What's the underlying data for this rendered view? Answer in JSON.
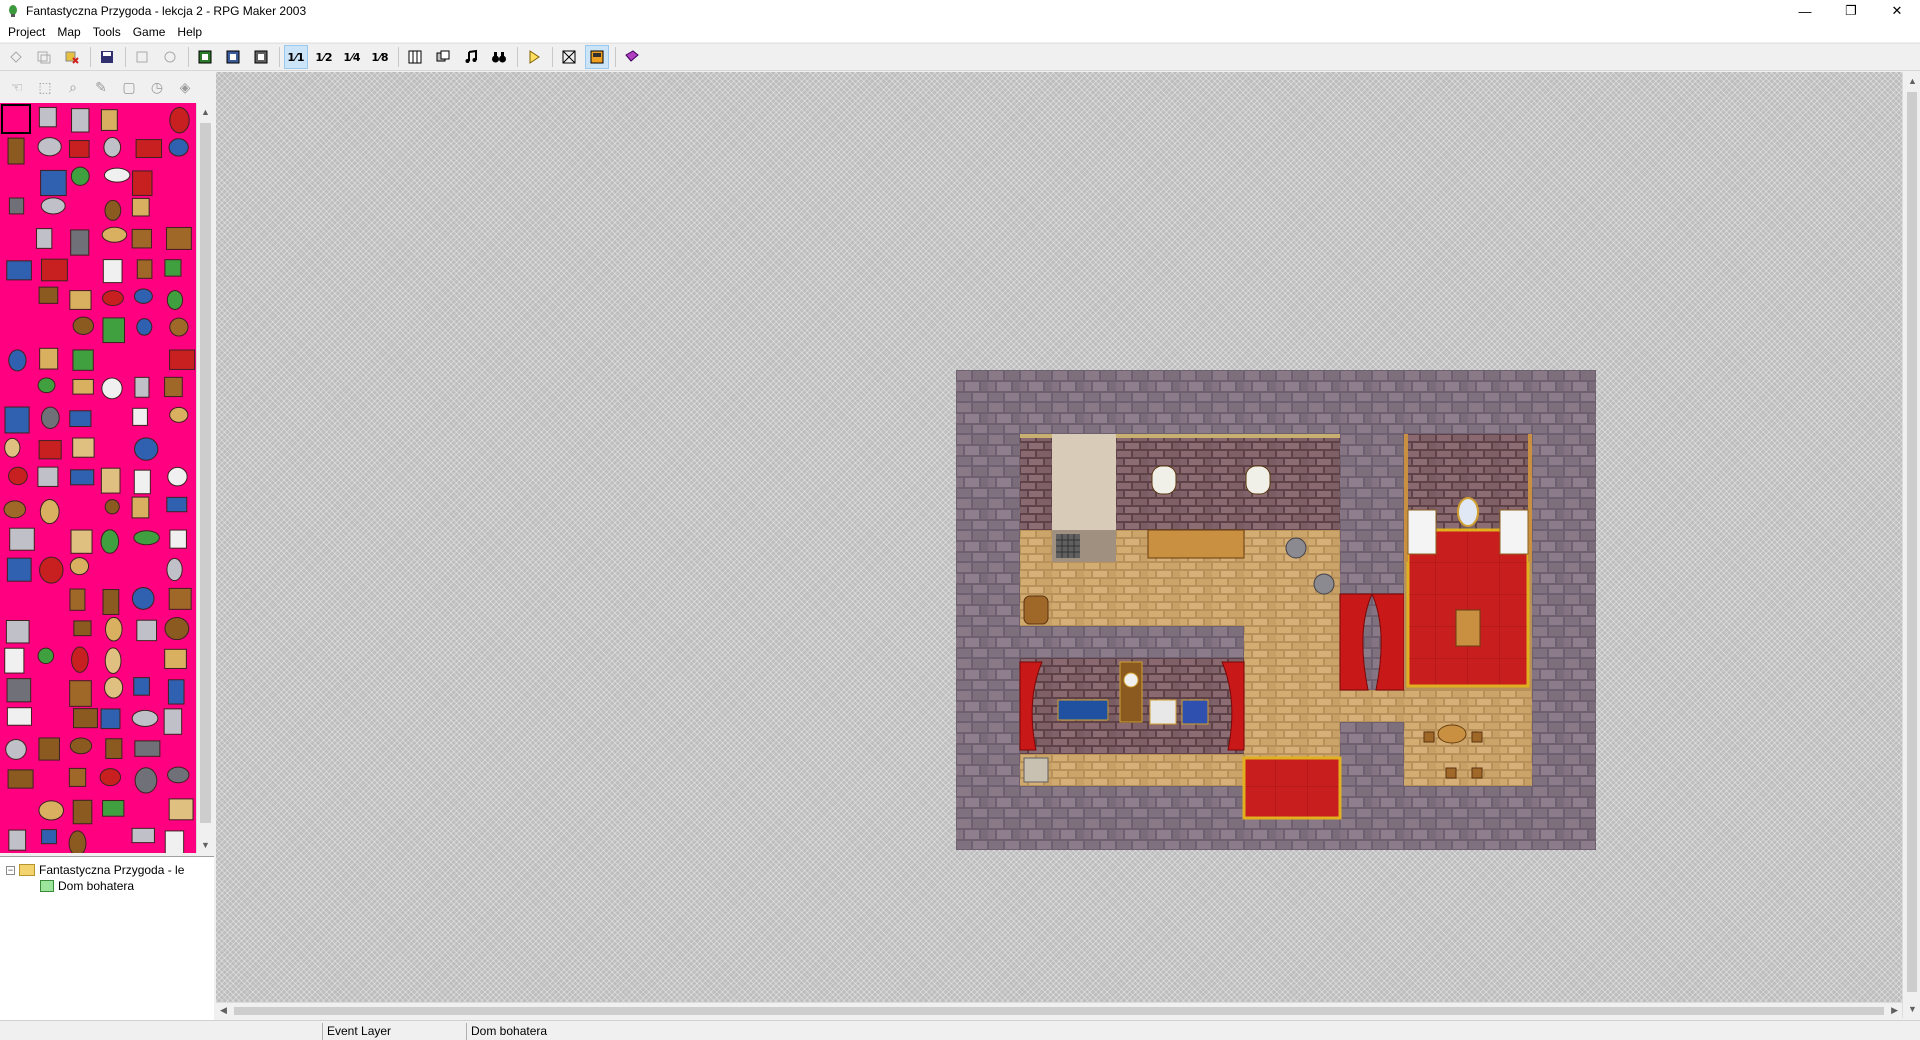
{
  "window": {
    "title": "Fantastyczna Przygoda - lekcja 2 - RPG Maker 2003",
    "minimize": "—",
    "restore": "❐",
    "close": "✕"
  },
  "menu": [
    "Project",
    "Map",
    "Tools",
    "Game",
    "Help"
  ],
  "toolbar": {
    "zoom_1_1": "1⁄1",
    "zoom_1_2": "1⁄2",
    "zoom_1_4": "1⁄4",
    "zoom_1_8": "1⁄8"
  },
  "tree": {
    "project": "Fantastyczna Przygoda - le",
    "map": "Dom bohatera",
    "collapse": "−"
  },
  "status": {
    "layer": "Event Layer",
    "map": "Dom bohatera"
  },
  "colors": {
    "palette_bg": "#ff0080",
    "wall_stone": "#7a6a78",
    "floor_wood": "#c9a063",
    "carpet_red": "#c81e1e",
    "carpet_border": "#e0b020"
  }
}
